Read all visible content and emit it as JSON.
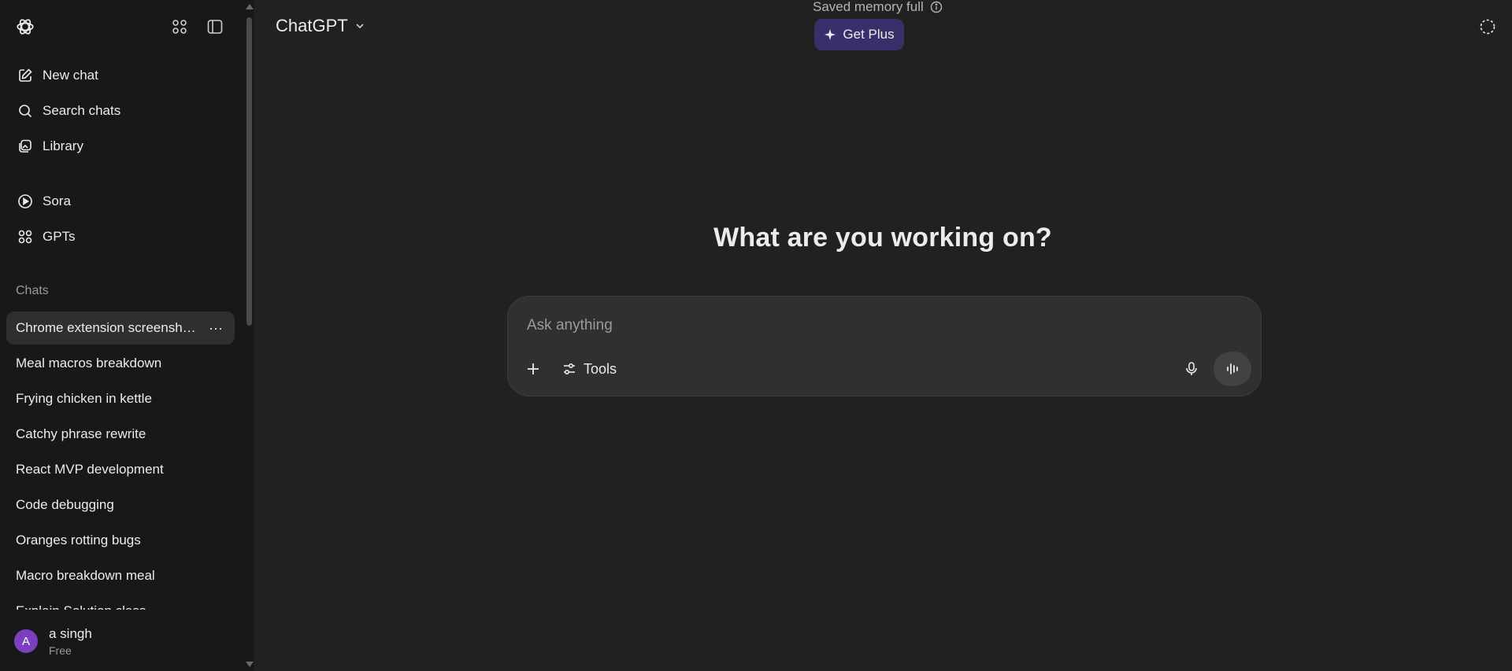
{
  "sidebar": {
    "nav": [
      {
        "label": "New chat",
        "icon": "edit-icon"
      },
      {
        "label": "Search chats",
        "icon": "search-icon"
      },
      {
        "label": "Library",
        "icon": "library-icon"
      },
      {
        "label": "Sora",
        "icon": "play-circle-icon"
      },
      {
        "label": "GPTs",
        "icon": "grid-icon"
      }
    ],
    "section_label": "Chats",
    "chats": [
      "Chrome extension screenshots",
      "Meal macros breakdown",
      "Frying chicken in kettle",
      "Catchy phrase rewrite",
      "React MVP development",
      "Code debugging",
      "Oranges rotting bugs",
      "Macro breakdown meal",
      "Explain Solution class"
    ],
    "more_label": "···",
    "user": {
      "initial": "A",
      "name": "a singh",
      "plan": "Free",
      "avatar_color": "#7b3fbf"
    }
  },
  "header": {
    "model": "ChatGPT",
    "memory_notice": "Saved memory full",
    "get_plus": "Get Plus",
    "get_plus_color": "#3b2f6b"
  },
  "main": {
    "heading": "What are you working on?",
    "composer": {
      "placeholder": "Ask anything",
      "tools_label": "Tools"
    }
  }
}
